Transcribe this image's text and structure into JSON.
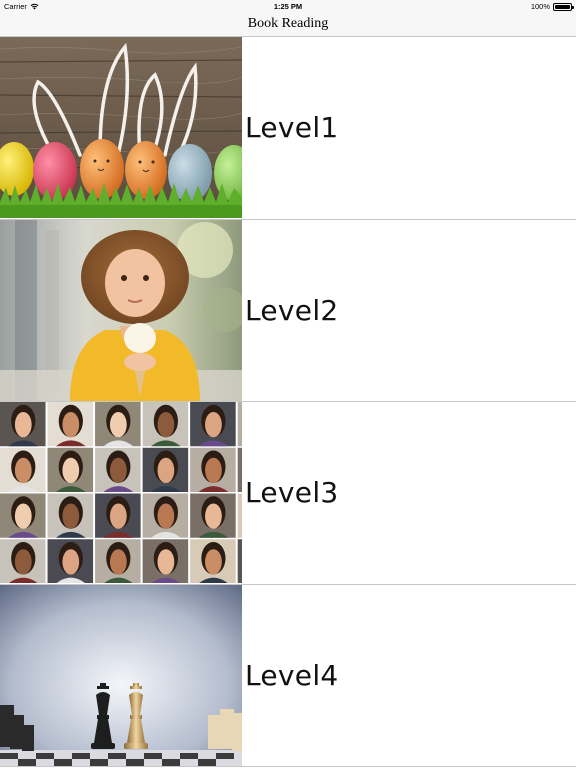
{
  "status_bar": {
    "carrier": "Carrier",
    "time": "1:25 PM",
    "battery": "100%"
  },
  "nav": {
    "title": "Book Reading"
  },
  "levels": [
    {
      "label": "Level1",
      "image": "easter-eggs-bunny-ears-image"
    },
    {
      "label": "Level2",
      "image": "girl-with-ice-cream-image"
    },
    {
      "label": "Level3",
      "image": "faces-collage-image"
    },
    {
      "label": "Level4",
      "image": "chess-kings-image"
    }
  ]
}
